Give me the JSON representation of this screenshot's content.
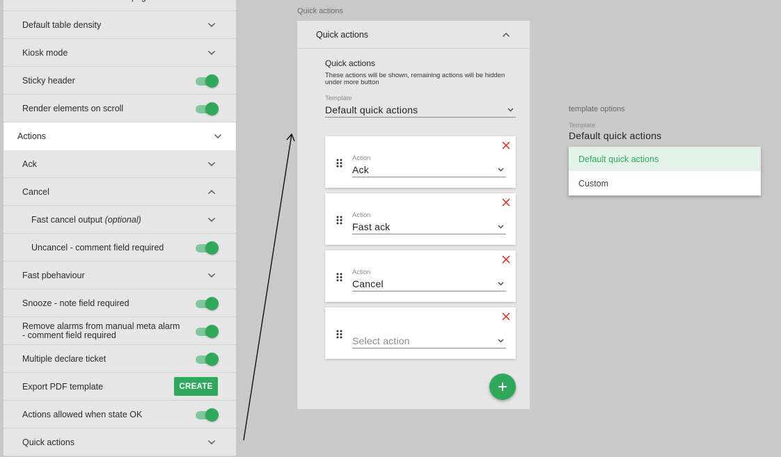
{
  "settings": {
    "rows": [
      {
        "label": "Default number of elements/page",
        "control": "chevron-down"
      },
      {
        "label": "Default table density",
        "control": "chevron-down"
      },
      {
        "label": "Kiosk mode",
        "control": "chevron-down"
      },
      {
        "label": "Sticky header",
        "control": "toggle",
        "on": true
      },
      {
        "label": "Render elements on scroll",
        "control": "toggle",
        "on": true
      },
      {
        "label": "Actions",
        "control": "chevron-down",
        "active": true
      },
      {
        "label": "Ack",
        "control": "chevron-down"
      },
      {
        "label": "Cancel",
        "control": "chevron-up"
      },
      {
        "label": "Fast cancel output",
        "optional": "(optional)",
        "control": "chevron-down",
        "sub": true
      },
      {
        "label": "Uncancel - comment field required",
        "control": "toggle",
        "on": true,
        "sub": true
      },
      {
        "label": "Fast pbehaviour",
        "control": "chevron-down"
      },
      {
        "label": "Snooze - note field required",
        "control": "toggle",
        "on": true
      },
      {
        "label": "Remove alarms from manual meta alarm - comment field required",
        "control": "toggle",
        "on": true
      },
      {
        "label": "Multiple declare ticket",
        "control": "toggle",
        "on": true
      },
      {
        "label": "Export PDF template",
        "control": "button",
        "button_label": "CREATE"
      },
      {
        "label": "Actions allowed when state OK",
        "control": "toggle",
        "on": true
      },
      {
        "label": "Quick actions",
        "control": "chevron-down"
      }
    ]
  },
  "quick_actions": {
    "caption": "Quick actions",
    "header_title": "Quick actions",
    "section_title": "Quick actions",
    "description": "These actions will be shown, remaining actions will be hidden under more button",
    "template": {
      "label": "Template",
      "value": "Default quick actions"
    },
    "actions": [
      {
        "label": "Action",
        "value": "Ack"
      },
      {
        "label": "Action",
        "value": "Fast ack"
      },
      {
        "label": "Action",
        "value": "Cancel"
      },
      {
        "label": "",
        "value": "",
        "placeholder": "Select action"
      }
    ]
  },
  "template_options": {
    "caption": "template options",
    "field_label": "Template",
    "field_value": "Default quick actions",
    "options": [
      {
        "label": "Default quick actions",
        "selected": true
      },
      {
        "label": "Custom",
        "selected": false
      }
    ]
  },
  "colors": {
    "accent": "#2fa85c",
    "toggle_track": "#7ec79b",
    "close": "#e53935",
    "selected_bg": "#e3f2e8"
  },
  "icons": {
    "collapse": "chevron-down-icon",
    "expand": "chevron-up-icon",
    "remove": "close-icon",
    "reorder": "drag-handle-icon",
    "add": "plus-icon"
  }
}
